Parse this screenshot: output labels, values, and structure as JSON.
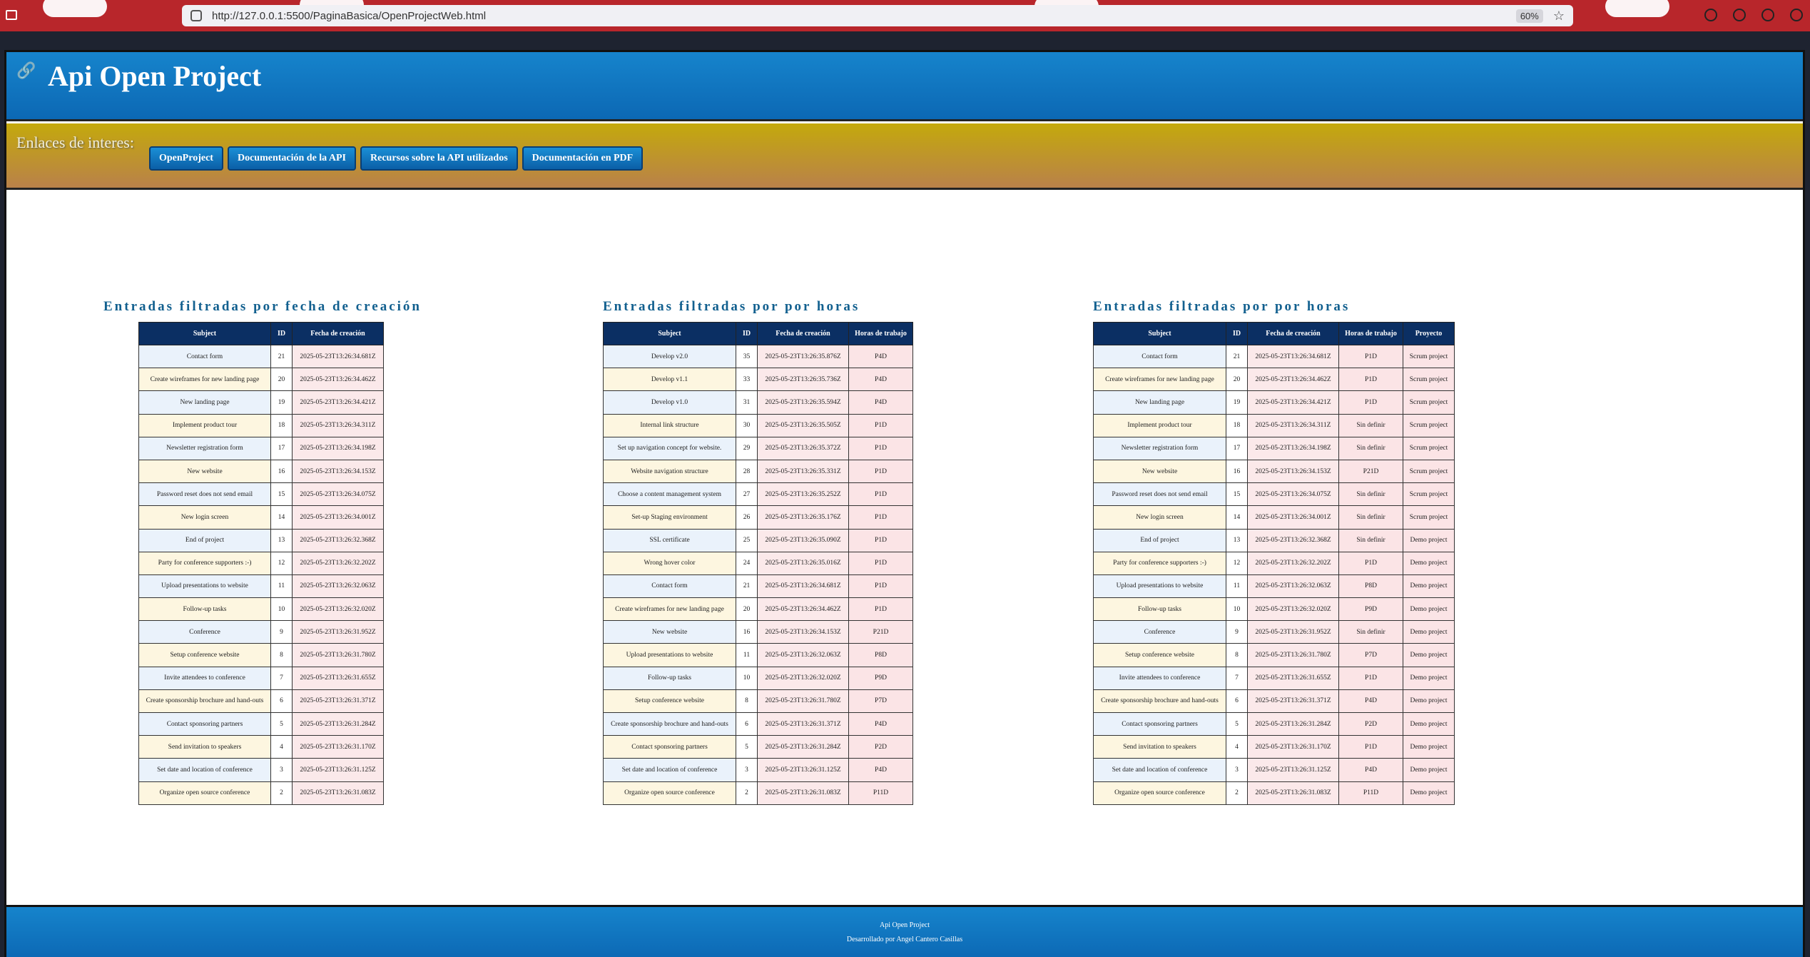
{
  "browser": {
    "url": "http://127.0.0.1:5500/PaginaBasica/OpenProjectWeb.html",
    "zoom": "60%"
  },
  "header": {
    "title": "Api Open Project"
  },
  "links": {
    "label": "Enlaces de interes:",
    "buttons": [
      "OpenProject",
      "Documentación de la API",
      "Recursos sobre la API utilizados",
      "Documentación en PDF"
    ]
  },
  "tables": [
    {
      "title": "Entradas filtradas por fecha de creación",
      "headers": [
        "Subject",
        "ID",
        "Fecha de creación"
      ],
      "rows": [
        [
          "Contact form",
          "21",
          "2025-05-23T13:26:34.681Z"
        ],
        [
          "Create wireframes for new landing page",
          "20",
          "2025-05-23T13:26:34.462Z"
        ],
        [
          "New landing page",
          "19",
          "2025-05-23T13:26:34.421Z"
        ],
        [
          "Implement product tour",
          "18",
          "2025-05-23T13:26:34.311Z"
        ],
        [
          "Newsletter registration form",
          "17",
          "2025-05-23T13:26:34.198Z"
        ],
        [
          "New website",
          "16",
          "2025-05-23T13:26:34.153Z"
        ],
        [
          "Password reset does not send email",
          "15",
          "2025-05-23T13:26:34.075Z"
        ],
        [
          "New login screen",
          "14",
          "2025-05-23T13:26:34.001Z"
        ],
        [
          "End of project",
          "13",
          "2025-05-23T13:26:32.368Z"
        ],
        [
          "Party for conference supporters :-)",
          "12",
          "2025-05-23T13:26:32.202Z"
        ],
        [
          "Upload presentations to website",
          "11",
          "2025-05-23T13:26:32.063Z"
        ],
        [
          "Follow-up tasks",
          "10",
          "2025-05-23T13:26:32.020Z"
        ],
        [
          "Conference",
          "9",
          "2025-05-23T13:26:31.952Z"
        ],
        [
          "Setup conference website",
          "8",
          "2025-05-23T13:26:31.780Z"
        ],
        [
          "Invite attendees to conference",
          "7",
          "2025-05-23T13:26:31.655Z"
        ],
        [
          "Create sponsorship brochure and hand-outs",
          "6",
          "2025-05-23T13:26:31.371Z"
        ],
        [
          "Contact sponsoring partners",
          "5",
          "2025-05-23T13:26:31.284Z"
        ],
        [
          "Send invitation to speakers",
          "4",
          "2025-05-23T13:26:31.170Z"
        ],
        [
          "Set date and location of conference",
          "3",
          "2025-05-23T13:26:31.125Z"
        ],
        [
          "Organize open source conference",
          "2",
          "2025-05-23T13:26:31.083Z"
        ]
      ]
    },
    {
      "title": "Entradas filtradas por por horas",
      "headers": [
        "Subject",
        "ID",
        "Fecha de creación",
        "Horas de trabajo"
      ],
      "rows": [
        [
          "Develop v2.0",
          "35",
          "2025-05-23T13:26:35.876Z",
          "P4D"
        ],
        [
          "Develop v1.1",
          "33",
          "2025-05-23T13:26:35.736Z",
          "P4D"
        ],
        [
          "Develop v1.0",
          "31",
          "2025-05-23T13:26:35.594Z",
          "P4D"
        ],
        [
          "Internal link structure",
          "30",
          "2025-05-23T13:26:35.505Z",
          "P1D"
        ],
        [
          "Set up navigation concept for website.",
          "29",
          "2025-05-23T13:26:35.372Z",
          "P1D"
        ],
        [
          "Website navigation structure",
          "28",
          "2025-05-23T13:26:35.331Z",
          "P1D"
        ],
        [
          "Choose a content management system",
          "27",
          "2025-05-23T13:26:35.252Z",
          "P1D"
        ],
        [
          "Set-up Staging environment",
          "26",
          "2025-05-23T13:26:35.176Z",
          "P1D"
        ],
        [
          "SSL certificate",
          "25",
          "2025-05-23T13:26:35.090Z",
          "P1D"
        ],
        [
          "Wrong hover color",
          "24",
          "2025-05-23T13:26:35.016Z",
          "P1D"
        ],
        [
          "Contact form",
          "21",
          "2025-05-23T13:26:34.681Z",
          "P1D"
        ],
        [
          "Create wireframes for new landing page",
          "20",
          "2025-05-23T13:26:34.462Z",
          "P1D"
        ],
        [
          "New website",
          "16",
          "2025-05-23T13:26:34.153Z",
          "P21D"
        ],
        [
          "Upload presentations to website",
          "11",
          "2025-05-23T13:26:32.063Z",
          "P8D"
        ],
        [
          "Follow-up tasks",
          "10",
          "2025-05-23T13:26:32.020Z",
          "P9D"
        ],
        [
          "Setup conference website",
          "8",
          "2025-05-23T13:26:31.780Z",
          "P7D"
        ],
        [
          "Create sponsorship brochure and hand-outs",
          "6",
          "2025-05-23T13:26:31.371Z",
          "P4D"
        ],
        [
          "Contact sponsoring partners",
          "5",
          "2025-05-23T13:26:31.284Z",
          "P2D"
        ],
        [
          "Set date and location of conference",
          "3",
          "2025-05-23T13:26:31.125Z",
          "P4D"
        ],
        [
          "Organize open source conference",
          "2",
          "2025-05-23T13:26:31.083Z",
          "P11D"
        ]
      ]
    },
    {
      "title": "Entradas filtradas por por horas",
      "headers": [
        "Subject",
        "ID",
        "Fecha de creación",
        "Horas de trabajo",
        "Proyecto"
      ],
      "rows": [
        [
          "Contact form",
          "21",
          "2025-05-23T13:26:34.681Z",
          "P1D",
          "Scrum project"
        ],
        [
          "Create wireframes for new landing page",
          "20",
          "2025-05-23T13:26:34.462Z",
          "P1D",
          "Scrum project"
        ],
        [
          "New landing page",
          "19",
          "2025-05-23T13:26:34.421Z",
          "P1D",
          "Scrum project"
        ],
        [
          "Implement product tour",
          "18",
          "2025-05-23T13:26:34.311Z",
          "Sin definir",
          "Scrum project"
        ],
        [
          "Newsletter registration form",
          "17",
          "2025-05-23T13:26:34.198Z",
          "Sin definir",
          "Scrum project"
        ],
        [
          "New website",
          "16",
          "2025-05-23T13:26:34.153Z",
          "P21D",
          "Scrum project"
        ],
        [
          "Password reset does not send email",
          "15",
          "2025-05-23T13:26:34.075Z",
          "Sin definir",
          "Scrum project"
        ],
        [
          "New login screen",
          "14",
          "2025-05-23T13:26:34.001Z",
          "Sin definir",
          "Scrum project"
        ],
        [
          "End of project",
          "13",
          "2025-05-23T13:26:32.368Z",
          "Sin definir",
          "Demo project"
        ],
        [
          "Party for conference supporters :-)",
          "12",
          "2025-05-23T13:26:32.202Z",
          "P1D",
          "Demo project"
        ],
        [
          "Upload presentations to website",
          "11",
          "2025-05-23T13:26:32.063Z",
          "P8D",
          "Demo project"
        ],
        [
          "Follow-up tasks",
          "10",
          "2025-05-23T13:26:32.020Z",
          "P9D",
          "Demo project"
        ],
        [
          "Conference",
          "9",
          "2025-05-23T13:26:31.952Z",
          "Sin definir",
          "Demo project"
        ],
        [
          "Setup conference website",
          "8",
          "2025-05-23T13:26:31.780Z",
          "P7D",
          "Demo project"
        ],
        [
          "Invite attendees to conference",
          "7",
          "2025-05-23T13:26:31.655Z",
          "P1D",
          "Demo project"
        ],
        [
          "Create sponsorship brochure and hand-outs",
          "6",
          "2025-05-23T13:26:31.371Z",
          "P4D",
          "Demo project"
        ],
        [
          "Contact sponsoring partners",
          "5",
          "2025-05-23T13:26:31.284Z",
          "P2D",
          "Demo project"
        ],
        [
          "Send invitation to speakers",
          "4",
          "2025-05-23T13:26:31.170Z",
          "P1D",
          "Demo project"
        ],
        [
          "Set date and location of conference",
          "3",
          "2025-05-23T13:26:31.125Z",
          "P4D",
          "Demo project"
        ],
        [
          "Organize open source conference",
          "2",
          "2025-05-23T13:26:31.083Z",
          "P11D",
          "Demo project"
        ]
      ]
    }
  ],
  "footer": {
    "line1": "Api Open Project",
    "line2": "Desarrollado por Angel Cantero Casillas"
  }
}
